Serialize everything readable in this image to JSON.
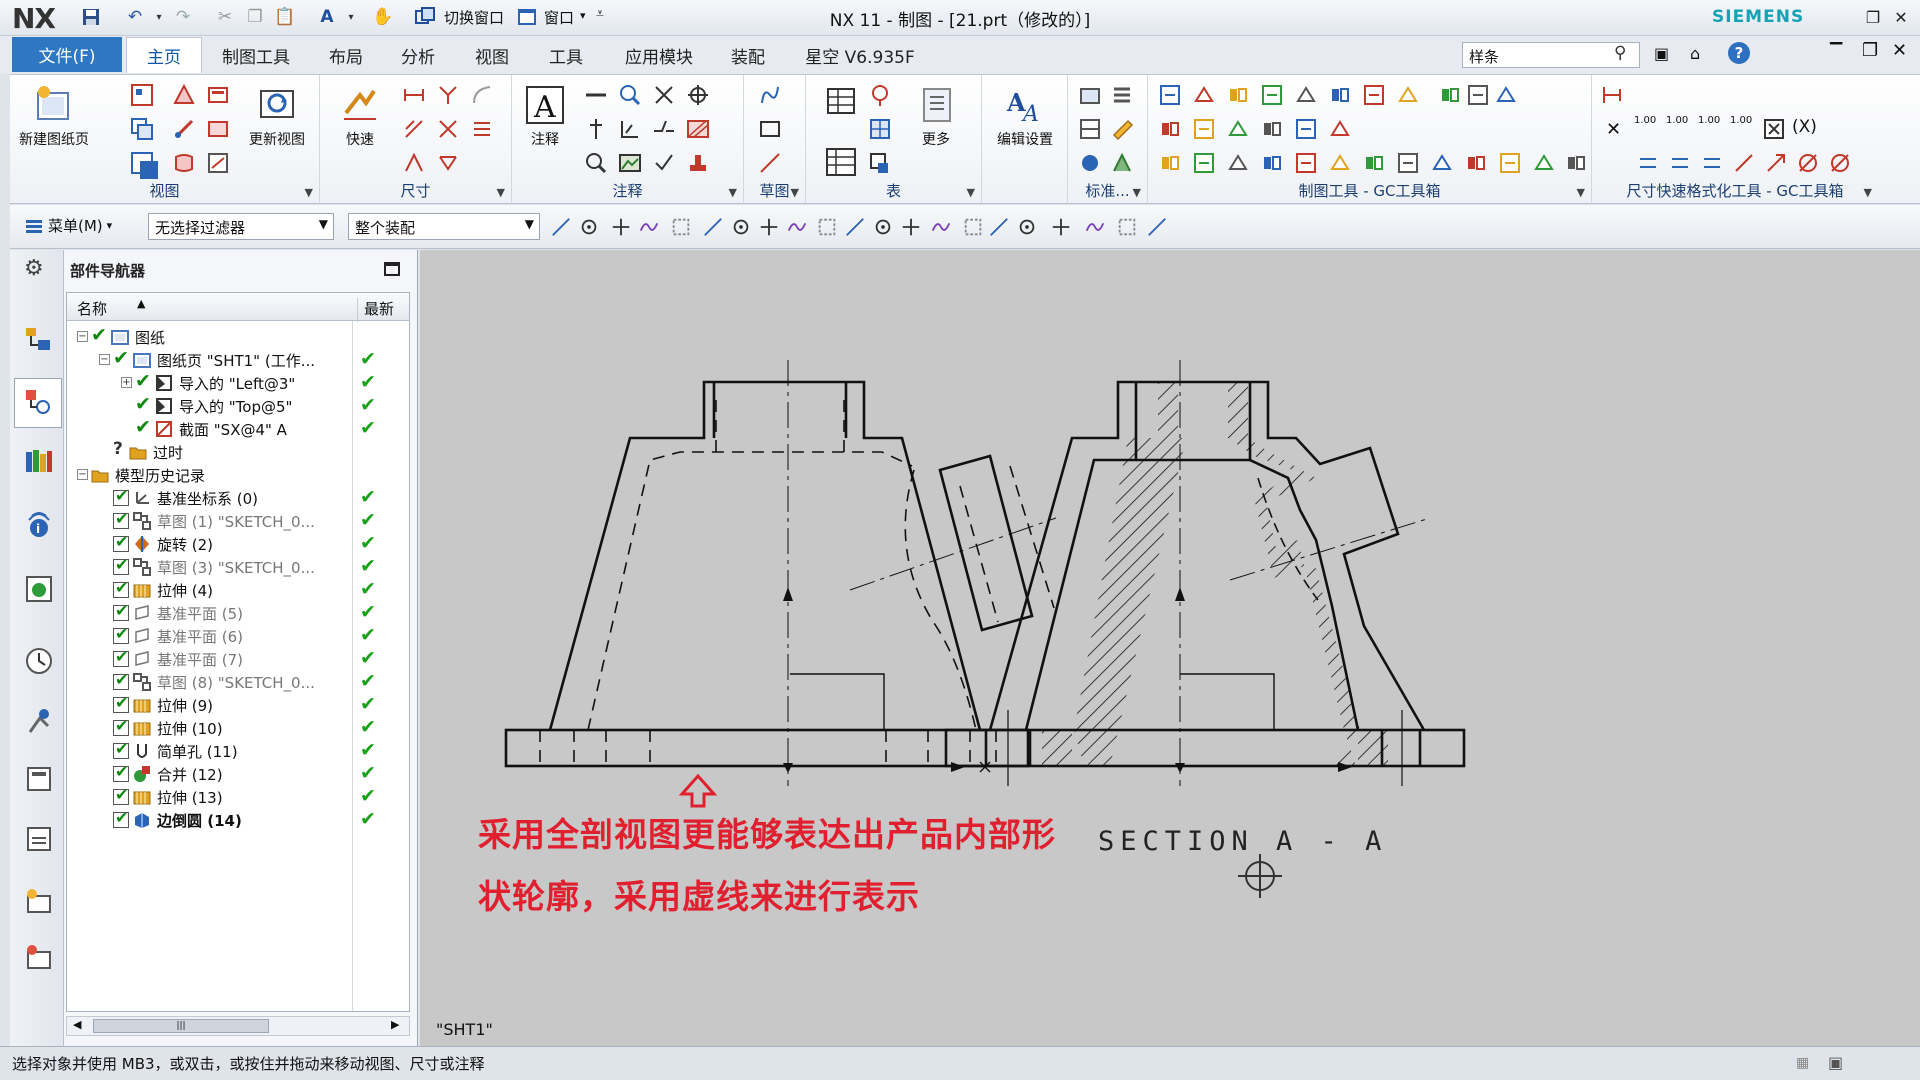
{
  "app": {
    "logo": "NX",
    "title": "NX 11 - 制图 - [21.prt（修改的）]",
    "brand": "SIEMENS"
  },
  "quick_access": {
    "switch_window": "切换窗口",
    "window": "窗口"
  },
  "ribbon": {
    "file_tab": "文件(F)",
    "tabs": [
      "主页",
      "制图工具",
      "布局",
      "分析",
      "视图",
      "工具",
      "应用模块",
      "装配",
      "星空 V6.935F"
    ],
    "active_tab": "主页",
    "search_value": "样条",
    "groups": {
      "view": {
        "label": "视图",
        "new_sheet": "新建图纸页",
        "update_view": "更新视图"
      },
      "dimension": {
        "label": "尺寸",
        "rapid": "快速"
      },
      "annotation": {
        "label": "注释",
        "note": "注释"
      },
      "sketch": {
        "label": "草图"
      },
      "table": {
        "label": "表",
        "more": "更多"
      },
      "edit": {
        "edit_settings": "编辑设置"
      },
      "standard": {
        "label": "标准..."
      },
      "gc_drafting": {
        "label": "制图工具 - GC工具箱"
      },
      "gc_dim": {
        "label": "尺寸快速格式化工具 - GC工具箱"
      }
    },
    "tol_labels": [
      "1.00",
      "1.00",
      "1.00",
      "1.00"
    ]
  },
  "selection_bar": {
    "menu": "菜单(M)",
    "filter": "无选择过滤器",
    "scope": "整个装配"
  },
  "navigator": {
    "title": "部件导航器",
    "col_name": "名称",
    "col_latest": "最新",
    "rows": [
      {
        "label": "图纸"
      },
      {
        "label": "图纸页 \"SHT1\" (工作..."
      },
      {
        "label": "导入的 \"Left@3\""
      },
      {
        "label": "导入的 \"Top@5\""
      },
      {
        "label": "截面 \"SX@4\" A"
      },
      {
        "label": "过时"
      },
      {
        "label": "模型历史记录"
      },
      {
        "label": "基准坐标系 (0)"
      },
      {
        "label": "草图 (1) \"SKETCH_0..."
      },
      {
        "label": "旋转 (2)"
      },
      {
        "label": "草图 (3) \"SKETCH_0..."
      },
      {
        "label": "拉伸 (4)"
      },
      {
        "label": "基准平面 (5)"
      },
      {
        "label": "基准平面 (6)"
      },
      {
        "label": "基准平面 (7)"
      },
      {
        "label": "草图 (8) \"SKETCH_0..."
      },
      {
        "label": "拉伸 (9)"
      },
      {
        "label": "拉伸 (10)"
      },
      {
        "label": "简单孔 (11)"
      },
      {
        "label": "合并 (12)"
      },
      {
        "label": "拉伸 (13)"
      },
      {
        "label": "边倒圆 (14)"
      }
    ]
  },
  "drawing": {
    "sheet_name": "\"SHT1\"",
    "section_label": "SECTION  A - A",
    "annotation_line1": "采用全剖视图更能够表达出产品内部形",
    "annotation_line2": "状轮廓，采用虚线来进行表示"
  },
  "status": {
    "text": "选择对象并使用 MB3，或双击，或按住并拖动来移动视图、尺寸或注释"
  },
  "colors": {
    "accent": "#2d77c3",
    "annotation": "#e0202f",
    "ok_check": "#1aa01a",
    "canvas_bg": "#c8c8c8"
  }
}
